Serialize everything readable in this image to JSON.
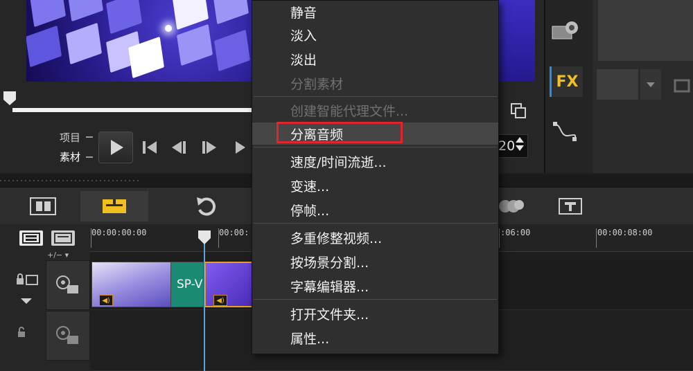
{
  "preview": {
    "label_project": "项目",
    "label_clip": "素材",
    "spin_value": "20"
  },
  "right_panel": {
    "fx_label": "FX"
  },
  "timeline": {
    "timecodes": [
      "00:00:00:00",
      "00:00:",
      ":06:00",
      "00:00:08:00"
    ],
    "zoom_label": "+/− ▾",
    "clip_title": "SP-V",
    "vol_glyph": "◀)"
  },
  "context_menu": {
    "items": [
      {
        "label": "静音"
      },
      {
        "label": "淡入"
      },
      {
        "label": "淡出"
      },
      {
        "label": "分割素材",
        "disabled": true
      },
      {
        "label": "创建智能代理文件...",
        "disabled": true
      },
      {
        "label": "分离音频",
        "highlighted": true
      },
      {
        "label": "速度/时间流逝..."
      },
      {
        "label": "变速..."
      },
      {
        "label": "停帧..."
      },
      {
        "label": "多重修整视频..."
      },
      {
        "label": "按场景分割..."
      },
      {
        "label": "字幕编辑器..."
      },
      {
        "label": "打开文件夹..."
      },
      {
        "label": "属性..."
      }
    ],
    "highlight_color": "#e0262d"
  },
  "colors": {
    "playhead": "#5aa6dc",
    "fx_text": "#f0c020",
    "clip_green": "#1a8a72",
    "active_tool": "#f0c020"
  }
}
